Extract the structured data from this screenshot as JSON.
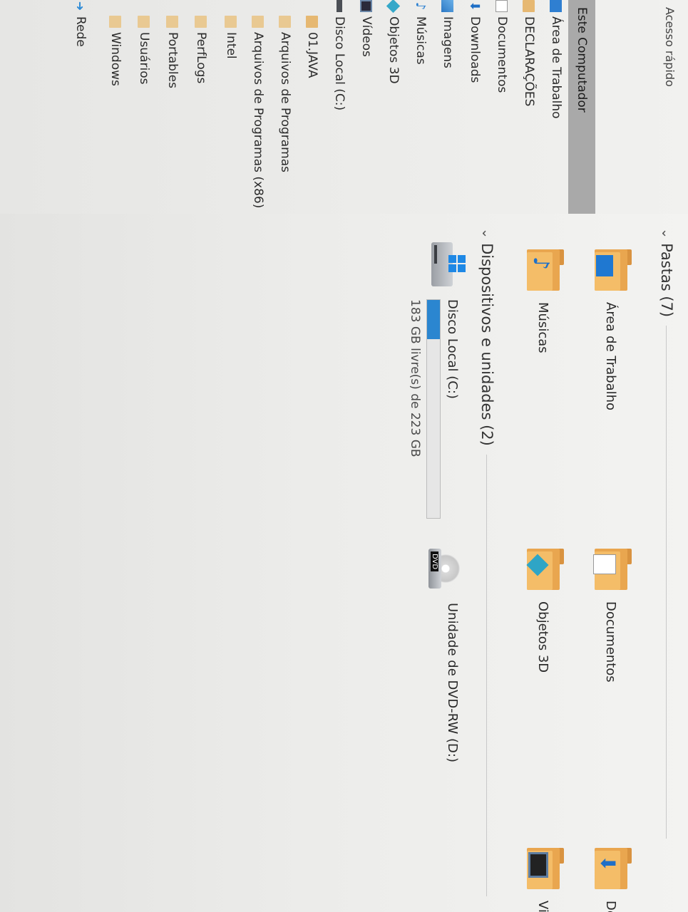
{
  "sidebar": {
    "quick_access": "Acesso rápido",
    "this_pc": "Este Computador",
    "items": [
      {
        "label": "Área de Trabalho",
        "icon": "desktop-icon"
      },
      {
        "label": "DECLARAÇÕES",
        "icon": "folder-icon"
      },
      {
        "label": "Documentos",
        "icon": "documents-icon"
      },
      {
        "label": "Downloads",
        "icon": "downloads-icon"
      },
      {
        "label": "Imagens",
        "icon": "pictures-icon"
      },
      {
        "label": "Músicas",
        "icon": "music-icon"
      },
      {
        "label": "Objetos 3D",
        "icon": "objects-3d-icon"
      },
      {
        "label": "Vídeos",
        "icon": "videos-icon"
      },
      {
        "label": "Disco Local (C:)",
        "icon": "drive-icon"
      },
      {
        "label": "01.JAVA",
        "icon": "folder-icon"
      },
      {
        "label": "Arquivos de Programas",
        "icon": "folder-icon"
      },
      {
        "label": "Arquivos de Programas (x86)",
        "icon": "folder-icon"
      },
      {
        "label": "Intel",
        "icon": "folder-icon"
      },
      {
        "label": "PerfLogs",
        "icon": "folder-icon"
      },
      {
        "label": "Portables",
        "icon": "folder-icon"
      },
      {
        "label": "Usuários",
        "icon": "folder-icon"
      },
      {
        "label": "Windows",
        "icon": "folder-icon"
      }
    ],
    "network": "Rede"
  },
  "content": {
    "folders_header": "Pastas (7)",
    "folders": [
      {
        "label": "Área de Trabalho",
        "icon": "desktop-folder-icon"
      },
      {
        "label": "Documentos",
        "icon": "documents-folder-icon"
      },
      {
        "label": "De",
        "icon": "downloads-folder-icon"
      },
      {
        "label": "Músicas",
        "icon": "music-folder-icon"
      },
      {
        "label": "Objetos 3D",
        "icon": "objects-3d-folder-icon"
      },
      {
        "label": "Vi",
        "icon": "videos-folder-icon"
      }
    ],
    "drives_header": "Dispositivos e unidades (2)",
    "drives": [
      {
        "name": "Disco Local (C:)",
        "free_text": "183 GB livre(s) de 223 GB",
        "used_fraction": 0.179,
        "icon": "hard-drive-icon"
      },
      {
        "name": "Unidade de DVD-RW (D:)",
        "icon": "dvd-drive-icon",
        "badge": "DVD"
      }
    ]
  },
  "colors": {
    "accent": "#2b86d0",
    "folder": "#f4bd68",
    "selected": "#a9a9a9"
  }
}
